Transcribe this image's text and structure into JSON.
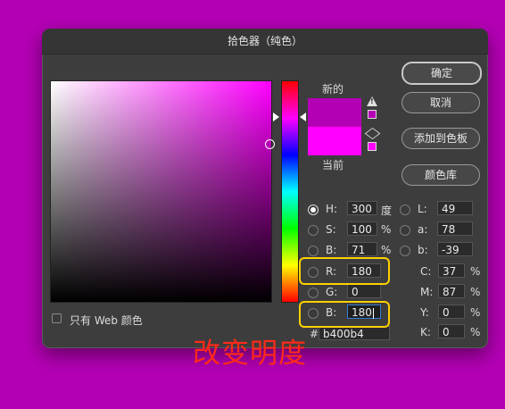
{
  "window": {
    "title": "拾色器（纯色）"
  },
  "colors": {
    "new": "#b400b4",
    "current": "#ff00ff",
    "background": "#b400b4"
  },
  "preview": {
    "new_label": "新的",
    "current_label": "当前"
  },
  "icons": {
    "gamut_warning": "warning-triangle-icon",
    "web_safe": "cube-icon"
  },
  "buttons": {
    "ok": "确定",
    "cancel": "取消",
    "add_swatch": "添加到色板",
    "libraries": "颜色库"
  },
  "hsb": {
    "h": {
      "label": "H:",
      "value": "300",
      "unit": "度"
    },
    "s": {
      "label": "S:",
      "value": "100",
      "unit": "%"
    },
    "b": {
      "label": "B:",
      "value": "71",
      "unit": "%"
    }
  },
  "rgb": {
    "r": {
      "label": "R:",
      "value": "180"
    },
    "g": {
      "label": "G:",
      "value": "0"
    },
    "b": {
      "label": "B:",
      "value": "180"
    }
  },
  "lab": {
    "l": {
      "label": "L:",
      "value": "49"
    },
    "a": {
      "label": "a:",
      "value": "78"
    },
    "b": {
      "label": "b:",
      "value": "-39"
    }
  },
  "cmyk": {
    "c": {
      "label": "C:",
      "value": "37",
      "unit": "%"
    },
    "m": {
      "label": "M:",
      "value": "87",
      "unit": "%"
    },
    "y": {
      "label": "Y:",
      "value": "0",
      "unit": "%"
    },
    "k": {
      "label": "K:",
      "value": "0",
      "unit": "%"
    }
  },
  "hex": {
    "label": "#",
    "value": "b400b4"
  },
  "web_only": {
    "label": "只有 Web 颜色"
  },
  "annotation": "改变明度"
}
